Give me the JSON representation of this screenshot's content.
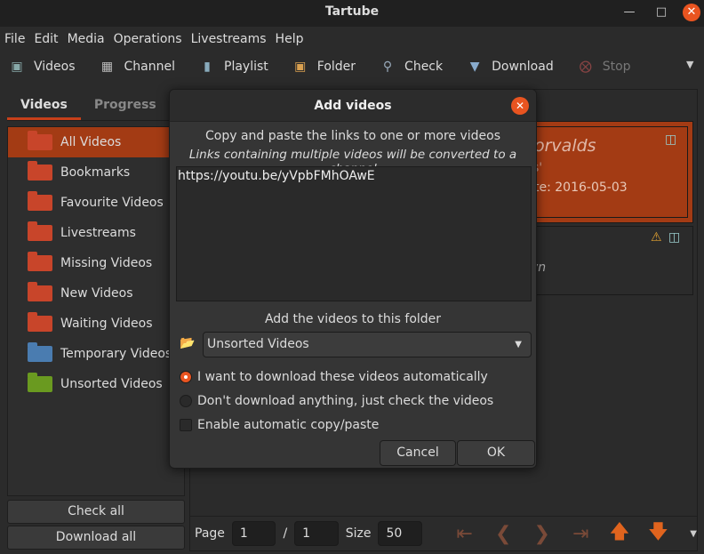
{
  "window": {
    "title": "Tartube"
  },
  "menu": [
    "File",
    "Edit",
    "Media",
    "Operations",
    "Livestreams",
    "Help"
  ],
  "toolbar": [
    {
      "label": "Videos",
      "icon": "video-icon"
    },
    {
      "label": "Channel",
      "icon": "channel-icon"
    },
    {
      "label": "Playlist",
      "icon": "playlist-icon"
    },
    {
      "label": "Folder",
      "icon": "folder-icon"
    },
    {
      "label": "Check",
      "icon": "check-icon"
    },
    {
      "label": "Download",
      "icon": "download-icon"
    },
    {
      "label": "Stop",
      "icon": "stop-icon",
      "disabled": true
    }
  ],
  "left": {
    "tabs": [
      "Videos",
      "Progress"
    ],
    "folders": [
      {
        "label": "All Videos",
        "color": "#c8452a",
        "selected": true
      },
      {
        "label": "Bookmarks",
        "color": "#c8452a"
      },
      {
        "label": "Favourite Videos",
        "color": "#c8452a"
      },
      {
        "label": "Livestreams",
        "color": "#c8452a"
      },
      {
        "label": "Missing Videos",
        "color": "#c8452a"
      },
      {
        "label": "New Videos",
        "color": "#c8452a"
      },
      {
        "label": "Waiting Videos",
        "color": "#c8452a"
      },
      {
        "label": "Temporary Videos",
        "color": "#4a7cb0"
      },
      {
        "label": "Unsorted Videos",
        "color": "#6a9a20"
      }
    ],
    "check_all": "Check all",
    "download_all": "Download all"
  },
  "right": {
    "card1": {
      "title_frag": "orvalds",
      "line2_frag": "s'",
      "date_frag": "te: 2016-05-03"
    },
    "card2": {
      "line_frag": "vn"
    }
  },
  "bottom": {
    "page_label": "Page",
    "page": "1",
    "sep": "/",
    "pages": "1",
    "size_label": "Size",
    "size": "50"
  },
  "dialog": {
    "title": "Add videos",
    "instruction": "Copy and paste the links to one or more videos",
    "note": "Links containing multiple videos will be converted to a channel",
    "links": "https://youtu.be/yVpbFMhOAwE",
    "folder_label": "Add the videos to this folder",
    "folder": "Unsorted Videos",
    "opt_download": "I want to download these videos automatically",
    "opt_check": "Don't download anything, just check the videos",
    "selected_option": "download",
    "auto_paste": "Enable automatic copy/paste",
    "auto_paste_checked": false,
    "cancel": "Cancel",
    "ok": "OK"
  },
  "colors": {
    "accent": "#e95420",
    "selection": "#a33b14"
  }
}
